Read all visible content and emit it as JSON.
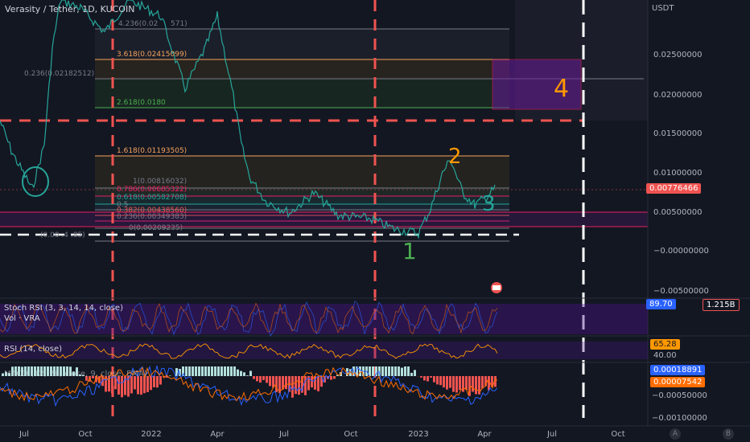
{
  "header": {
    "title": "Verasity / Tether, 1D, KUCOIN"
  },
  "price_axis": {
    "currency": "USDT",
    "ticks": [
      "0.02500000",
      "0.02000000",
      "0.01500000",
      "0.01000000",
      "0.00500000",
      "−0.00000000",
      "−0.00500000"
    ],
    "current_price": "0.00776466"
  },
  "time_axis": {
    "labels": [
      "Jul",
      "Oct",
      "2022",
      "Apr",
      "Jul",
      "Oct",
      "2023",
      "Apr",
      "Jul",
      "Oct"
    ]
  },
  "fib_labels": {
    "f4236": "4.236(0.02",
    "f4236b": "571)",
    "f3618": "3.618(0.02415099)",
    "f2618": "2.618(0.0180",
    "f1618": "1.618(0.01193505)",
    "f1": "1(0.00816032)",
    "f0786": "0.786(0.00685322)",
    "f0618": "0.618(0.00582708)",
    "f05": "0.5",
    "f0382": "0.382(0.00438560)",
    "f0236": "0.236(0.00349383)",
    "f0": "0(0.00209235)",
    "f0236top": "0.236(0.02182512)",
    "partial": "(0.00 .4 .85)"
  },
  "wave_labels": {
    "w1": "1",
    "w2": "2",
    "w3": "3",
    "w4": "4"
  },
  "indicators": {
    "stoch_rsi": {
      "label": "Stoch RSI (3, 3, 14, 14, close)",
      "value": "89.70"
    },
    "volume": {
      "label": "Vol · VRA",
      "value": "1.215B"
    },
    "rsi": {
      "label": "RSI (14, close)",
      "value": "65.28",
      "level": "40.00"
    },
    "macd": {
      "label": "MACD (12, 26, close, 9, close, EMA)",
      "value1": "0.00018891",
      "value2": "0.00007542",
      "ticks": [
        "−0.00050000",
        "−0.00100000"
      ]
    }
  },
  "corner_buttons": {
    "a": "A",
    "b": "B"
  },
  "colors": {
    "background": "#131722",
    "fib_orange": "#f7a35c",
    "red_dash": "#ef5350",
    "teal": "#26a69a",
    "wave_green": "#4caf50",
    "wave_orange": "#ff9800",
    "purple_band": "#7b1fa2",
    "macd_blue": "#2962ff",
    "macd_orange": "#ff6d00"
  }
}
